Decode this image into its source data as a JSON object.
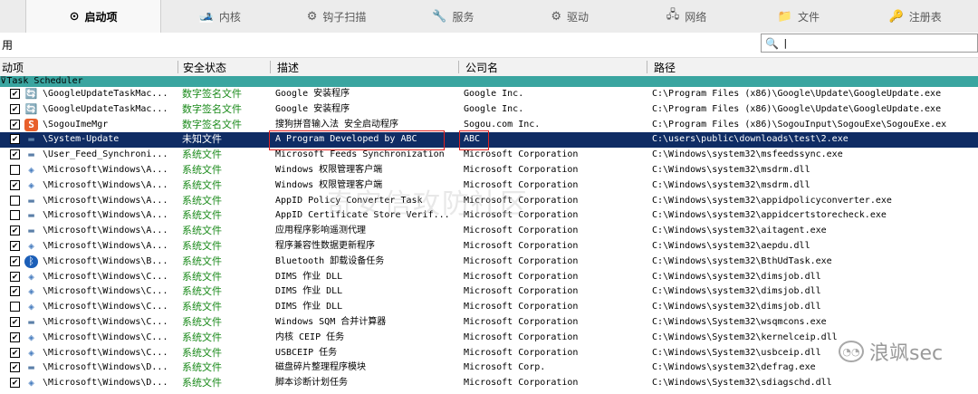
{
  "tabs": [
    {
      "label": "启动项",
      "icon": "radio-icon",
      "glyph": "⊙",
      "active": true
    },
    {
      "label": "内核",
      "icon": "kernel-icon",
      "glyph": "🎿",
      "active": false
    },
    {
      "label": "钩子扫描",
      "icon": "hook-icon",
      "glyph": "⚙",
      "active": false
    },
    {
      "label": "服务",
      "icon": "service-icon",
      "glyph": "🔧",
      "active": false
    },
    {
      "label": "驱动",
      "icon": "driver-icon",
      "glyph": "⚙",
      "active": false
    },
    {
      "label": "网络",
      "icon": "network-icon",
      "glyph": "🖧",
      "active": false
    },
    {
      "label": "文件",
      "icon": "file-icon",
      "glyph": "📁",
      "active": false
    },
    {
      "label": "注册表",
      "icon": "registry-icon",
      "glyph": "🔑",
      "active": false
    }
  ],
  "toolbar": {
    "label": "用",
    "search_value": "|"
  },
  "columns": {
    "name": "动项",
    "signature": "安全状态",
    "description": "描述",
    "company": "公司名",
    "path": "路径"
  },
  "group": {
    "label": "Task Scheduler"
  },
  "rows": [
    {
      "checked": true,
      "icon": "google-update-icon",
      "glyph": "🔄",
      "name": "\\GoogleUpdateTaskMac...",
      "signature": "数字签名文件",
      "description": "Google 安装程序",
      "company": "Google Inc.",
      "path": "C:\\Program Files (x86)\\Google\\Update\\GoogleUpdate.exe"
    },
    {
      "checked": true,
      "icon": "google-update-icon",
      "glyph": "🔄",
      "name": "\\GoogleUpdateTaskMac...",
      "signature": "数字签名文件",
      "description": "Google 安装程序",
      "company": "Google Inc.",
      "path": "C:\\Program Files (x86)\\Google\\Update\\GoogleUpdate.exe"
    },
    {
      "checked": true,
      "icon": "sogou-icon",
      "glyph": "S",
      "name": "\\SogouImeMgr",
      "signature": "数字签名文件",
      "description": "搜狗拼音输入法 安全启动程序",
      "company": "Sogou.com Inc.",
      "path": "C:\\Program Files (x86)\\SogouInput\\SogouExe\\SogouExe.ex"
    },
    {
      "checked": true,
      "icon": "window-icon",
      "glyph": "▬",
      "name": "\\System-Update",
      "signature": "未知文件",
      "description": "A Program Developed by ABC",
      "company": "ABC",
      "path": "C:\\users\\public\\downloads\\test\\2.exe",
      "selected": true
    },
    {
      "checked": true,
      "icon": "window-icon",
      "glyph": "▬",
      "name": "\\User_Feed_Synchroni...",
      "signature": "系统文件",
      "description": "Microsoft Feeds Synchronization",
      "company": "Microsoft Corporation",
      "path": "C:\\Windows\\system32\\msfeedssync.exe"
    },
    {
      "checked": false,
      "icon": "app-icon",
      "glyph": "◈",
      "name": "\\Microsoft\\Windows\\A...",
      "signature": "系统文件",
      "description": "Windows 权限管理客户端",
      "company": "Microsoft Corporation",
      "path": "C:\\Windows\\system32\\msdrm.dll"
    },
    {
      "checked": true,
      "icon": "app-icon",
      "glyph": "◈",
      "name": "\\Microsoft\\Windows\\A...",
      "signature": "系统文件",
      "description": "Windows 权限管理客户端",
      "company": "Microsoft Corporation",
      "path": "C:\\Windows\\system32\\msdrm.dll"
    },
    {
      "checked": false,
      "icon": "window-icon",
      "glyph": "▬",
      "name": "\\Microsoft\\Windows\\A...",
      "signature": "系统文件",
      "description": "AppID Policy Converter Task",
      "company": "Microsoft Corporation",
      "path": "C:\\Windows\\system32\\appidpolicyconverter.exe"
    },
    {
      "checked": false,
      "icon": "window-icon",
      "glyph": "▬",
      "name": "\\Microsoft\\Windows\\A...",
      "signature": "系统文件",
      "description": "AppID Certificate Store Verif...",
      "company": "Microsoft Corporation",
      "path": "C:\\Windows\\system32\\appidcertstorecheck.exe"
    },
    {
      "checked": true,
      "icon": "window-icon",
      "glyph": "▬",
      "name": "\\Microsoft\\Windows\\A...",
      "signature": "系统文件",
      "description": "应用程序影响遥测代理",
      "company": "Microsoft Corporation",
      "path": "C:\\Windows\\system32\\aitagent.exe"
    },
    {
      "checked": true,
      "icon": "app-icon",
      "glyph": "◈",
      "name": "\\Microsoft\\Windows\\A...",
      "signature": "系统文件",
      "description": "程序兼容性数据更新程序",
      "company": "Microsoft Corporation",
      "path": "C:\\Windows\\system32\\aepdu.dll"
    },
    {
      "checked": true,
      "icon": "bluetooth-icon",
      "glyph": "ᛒ",
      "name": "\\Microsoft\\Windows\\B...",
      "signature": "系统文件",
      "description": "Bluetooth 卸载设备任务",
      "company": "Microsoft Corporation",
      "path": "C:\\Windows\\system32\\BthUdTask.exe"
    },
    {
      "checked": true,
      "icon": "app-icon",
      "glyph": "◈",
      "name": "\\Microsoft\\Windows\\C...",
      "signature": "系统文件",
      "description": "DIMS 作业 DLL",
      "company": "Microsoft Corporation",
      "path": "C:\\Windows\\system32\\dimsjob.dll"
    },
    {
      "checked": true,
      "icon": "app-icon",
      "glyph": "◈",
      "name": "\\Microsoft\\Windows\\C...",
      "signature": "系统文件",
      "description": "DIMS 作业 DLL",
      "company": "Microsoft Corporation",
      "path": "C:\\Windows\\system32\\dimsjob.dll"
    },
    {
      "checked": false,
      "icon": "app-icon",
      "glyph": "◈",
      "name": "\\Microsoft\\Windows\\C...",
      "signature": "系统文件",
      "description": "DIMS 作业 DLL",
      "company": "Microsoft Corporation",
      "path": "C:\\Windows\\system32\\dimsjob.dll"
    },
    {
      "checked": true,
      "icon": "window-icon",
      "glyph": "▬",
      "name": "\\Microsoft\\Windows\\C...",
      "signature": "系统文件",
      "description": "Windows SQM 合并计算器",
      "company": "Microsoft Corporation",
      "path": "C:\\Windows\\System32\\wsqmcons.exe"
    },
    {
      "checked": true,
      "icon": "app-icon",
      "glyph": "◈",
      "name": "\\Microsoft\\Windows\\C...",
      "signature": "系统文件",
      "description": "内核 CEIP 任务",
      "company": "Microsoft Corporation",
      "path": "C:\\Windows\\System32\\kernelceip.dll"
    },
    {
      "checked": true,
      "icon": "app-icon",
      "glyph": "◈",
      "name": "\\Microsoft\\Windows\\C...",
      "signature": "系统文件",
      "description": "USBCEIP 任务",
      "company": "Microsoft Corporation",
      "path": "C:\\Windows\\System32\\usbceip.dll"
    },
    {
      "checked": true,
      "icon": "window-icon",
      "glyph": "▬",
      "name": "\\Microsoft\\Windows\\D...",
      "signature": "系统文件",
      "description": "磁盘碎片整理程序模块",
      "company": "Microsoft Corp.",
      "path": "C:\\Windows\\system32\\defrag.exe"
    },
    {
      "checked": true,
      "icon": "app-icon",
      "glyph": "◈",
      "name": "\\Microsoft\\Windows\\D...",
      "signature": "系统文件",
      "description": "脚本诊断计划任务",
      "company": "Microsoft Corporation",
      "path": "C:\\Windows\\System32\\sdiagschd.dll"
    }
  ],
  "watermark": {
    "text": "奇安信攻防社区"
  },
  "brand": {
    "text": "浪飒sec",
    "icon": "wechat-icon"
  },
  "colors": {
    "group_bg": "#3aa5a0",
    "selected_bg": "#0f2c64",
    "signature_text": "#1a8a1a",
    "highlight": "#e02020"
  }
}
